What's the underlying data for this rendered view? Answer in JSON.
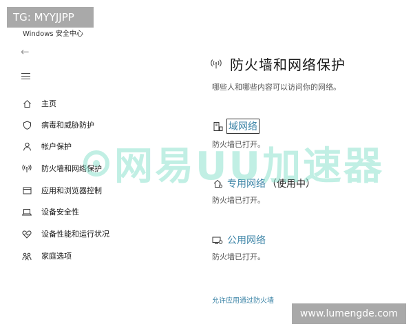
{
  "window": {
    "title": "Windows 安全中心"
  },
  "nav": {
    "back_icon": "back-arrow-icon",
    "menu_icon": "hamburger-icon",
    "items": [
      {
        "label": "主页",
        "icon": "home-icon"
      },
      {
        "label": "病毒和威胁防护",
        "icon": "shield-icon"
      },
      {
        "label": "帐户保护",
        "icon": "person-icon"
      },
      {
        "label": "防火墙和网络保护",
        "icon": "wifi-signal-icon"
      },
      {
        "label": "应用和浏览器控制",
        "icon": "app-window-icon"
      },
      {
        "label": "设备安全性",
        "icon": "laptop-icon"
      },
      {
        "label": "设备性能和运行状况",
        "icon": "heart-icon"
      },
      {
        "label": "家庭选项",
        "icon": "family-icon"
      }
    ]
  },
  "main": {
    "title": "防火墙和网络保护",
    "title_icon": "wifi-signal-icon",
    "subtitle": "哪些人和哪些内容可以访问你的网络。",
    "networks": [
      {
        "name": "域网络",
        "suffix": "",
        "status": "防火墙已打开。",
        "icon": "domain-network-icon"
      },
      {
        "name": "专用网络",
        "suffix": "（使用中）",
        "status": "防火墙已打开。",
        "icon": "private-network-icon"
      },
      {
        "name": "公用网络",
        "suffix": "",
        "status": "防火墙已打开。",
        "icon": "public-network-icon"
      }
    ],
    "allow_link": "允许应用通过防火墙"
  },
  "overlays": {
    "watermark": "网易UU加速器",
    "tg_badge": "TG: MYYJJPP",
    "url_badge": "www.lumengde.com"
  },
  "colors": {
    "accent": "#3f86a8",
    "watermark": "#8fe3cf",
    "badge_bg": "#a9a9a9"
  }
}
